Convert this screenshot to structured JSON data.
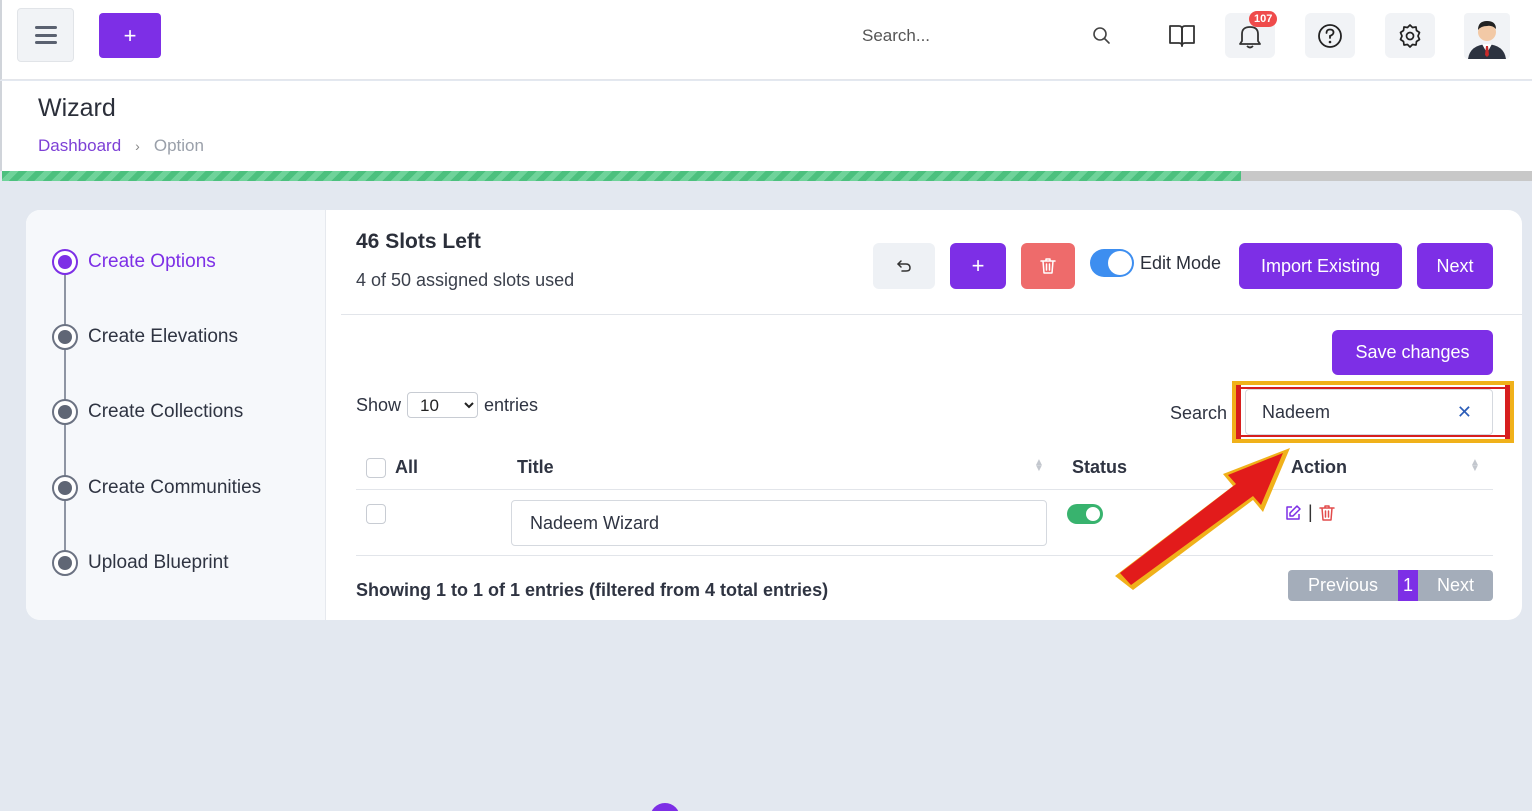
{
  "topbar": {
    "search_placeholder": "Search...",
    "notification_count": "107"
  },
  "header": {
    "title": "Wizard",
    "breadcrumb": [
      "Dashboard",
      "Option"
    ]
  },
  "progress_fraction": 0.81,
  "steps": [
    {
      "label": "Create Options",
      "active": true
    },
    {
      "label": "Create Elevations",
      "active": false
    },
    {
      "label": "Create Collections",
      "active": false
    },
    {
      "label": "Create Communities",
      "active": false
    },
    {
      "label": "Upload Blueprint",
      "active": false
    }
  ],
  "main": {
    "slots_title": "46 Slots Left",
    "slots_sub": "4 of 50 assigned slots used",
    "edit_mode_label": "Edit Mode",
    "import_label": "Import Existing",
    "next_label": "Next",
    "save_label": "Save changes"
  },
  "table": {
    "show_label": "Show",
    "entries_label": "entries",
    "page_size": "10",
    "search_label": "Search",
    "search_value": "Nadeem",
    "columns": [
      "All",
      "Title",
      "Status",
      "Action"
    ],
    "rows": [
      {
        "title": "Nadeem Wizard",
        "status": "on"
      }
    ],
    "info": "Showing 1 to 1 of 1 entries (filtered from 4 total entries)",
    "pager": {
      "previous": "Previous",
      "current": "1",
      "next": "Next"
    }
  },
  "colors": {
    "accent": "#7d2fe6",
    "danger": "#ee6b6b",
    "success": "#38b36e"
  }
}
